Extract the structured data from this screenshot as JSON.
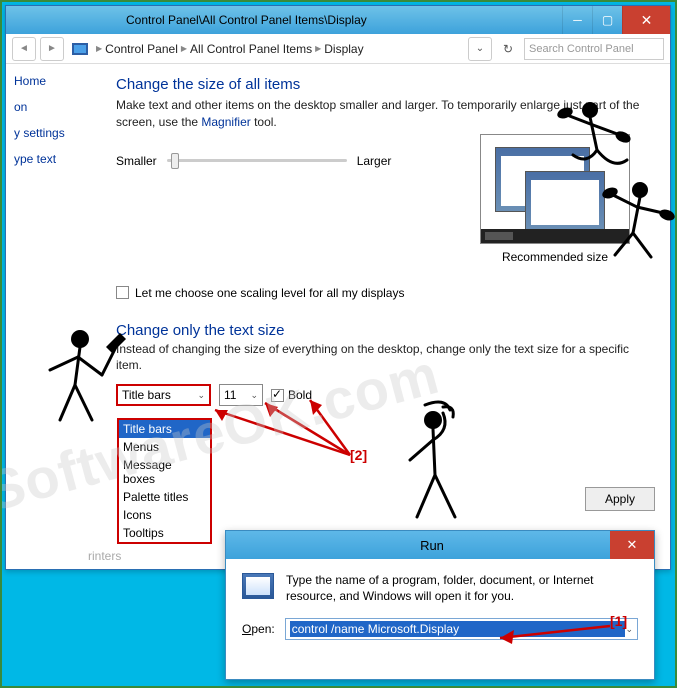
{
  "titlebar": {
    "path": "Control Panel\\All Control Panel Items\\Display"
  },
  "breadcrumb": {
    "items": [
      "Control Panel",
      "All Control Panel Items",
      "Display"
    ]
  },
  "search": {
    "placeholder": "Search Control Panel"
  },
  "sidebar": {
    "items": [
      "Home",
      "on",
      "y settings",
      "ype text"
    ],
    "bottom": "rinters"
  },
  "main": {
    "h1a": "Change the size of all items",
    "desc1a": "Make text and other items on the desktop smaller and larger. To temporarily enlarge just part of the screen, use the ",
    "magnifier": "Magnifier",
    "desc1b": " tool.",
    "smaller": "Smaller",
    "larger": "Larger",
    "recommended": "Recommended size",
    "scaling_chk": "Let me choose one scaling level for all my displays",
    "h1b": "Change only the text size",
    "desc2": "Instead of changing the size of everything on the desktop, change only the text size for a specific item.",
    "item_select": "Title bars",
    "size_select": "11",
    "bold_label": "Bold",
    "dropdown_options": [
      "Title bars",
      "Menus",
      "Message boxes",
      "Palette titles",
      "Icons",
      "Tooltips"
    ],
    "apply": "Apply"
  },
  "run": {
    "title": "Run",
    "desc": "Type the name of a program, folder, document, or Internet resource, and Windows will open it for you.",
    "open_label_u": "O",
    "open_label_rest": "pen:",
    "open_value": "control /name Microsoft.Display"
  },
  "anno": {
    "one": "[1]",
    "two": "[2]"
  },
  "watermark": "SoftwareOK.com"
}
